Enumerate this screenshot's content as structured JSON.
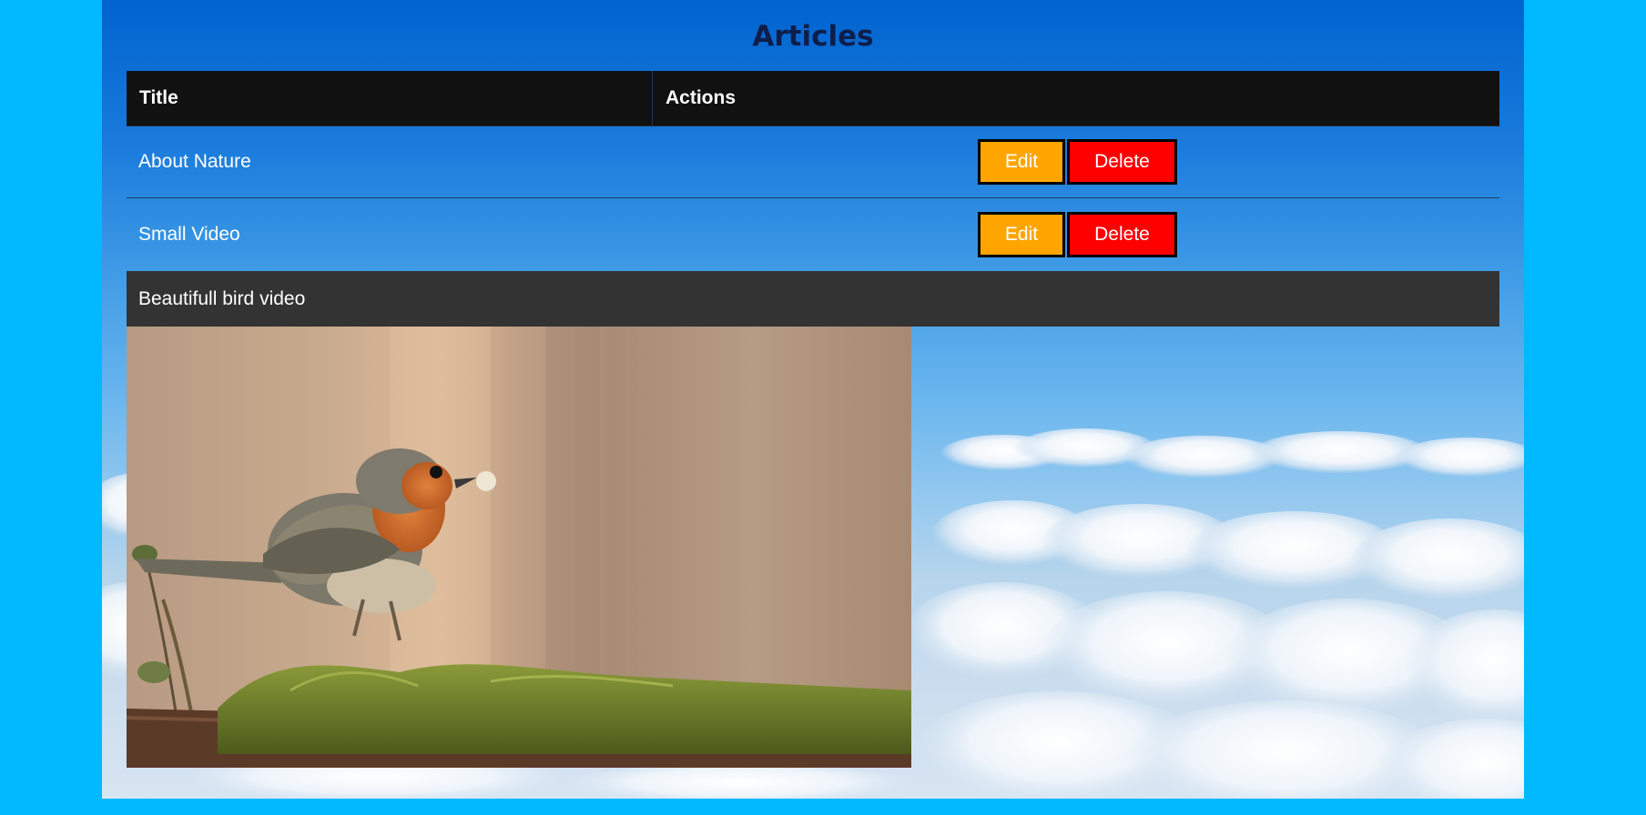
{
  "page": {
    "title": "Articles"
  },
  "table": {
    "headers": {
      "title": "Title",
      "actions": "Actions"
    },
    "rows": [
      {
        "title": "About Nature",
        "edit_label": "Edit",
        "delete_label": "Delete"
      },
      {
        "title": "Small Video",
        "edit_label": "Edit",
        "delete_label": "Delete"
      }
    ]
  },
  "video": {
    "caption": "Beautifull bird video"
  },
  "colors": {
    "outer_background": "#00b9ff",
    "header_background": "#111111",
    "edit_button": "#ffa500",
    "delete_button": "#ff0000",
    "video_bar": "#333333"
  }
}
